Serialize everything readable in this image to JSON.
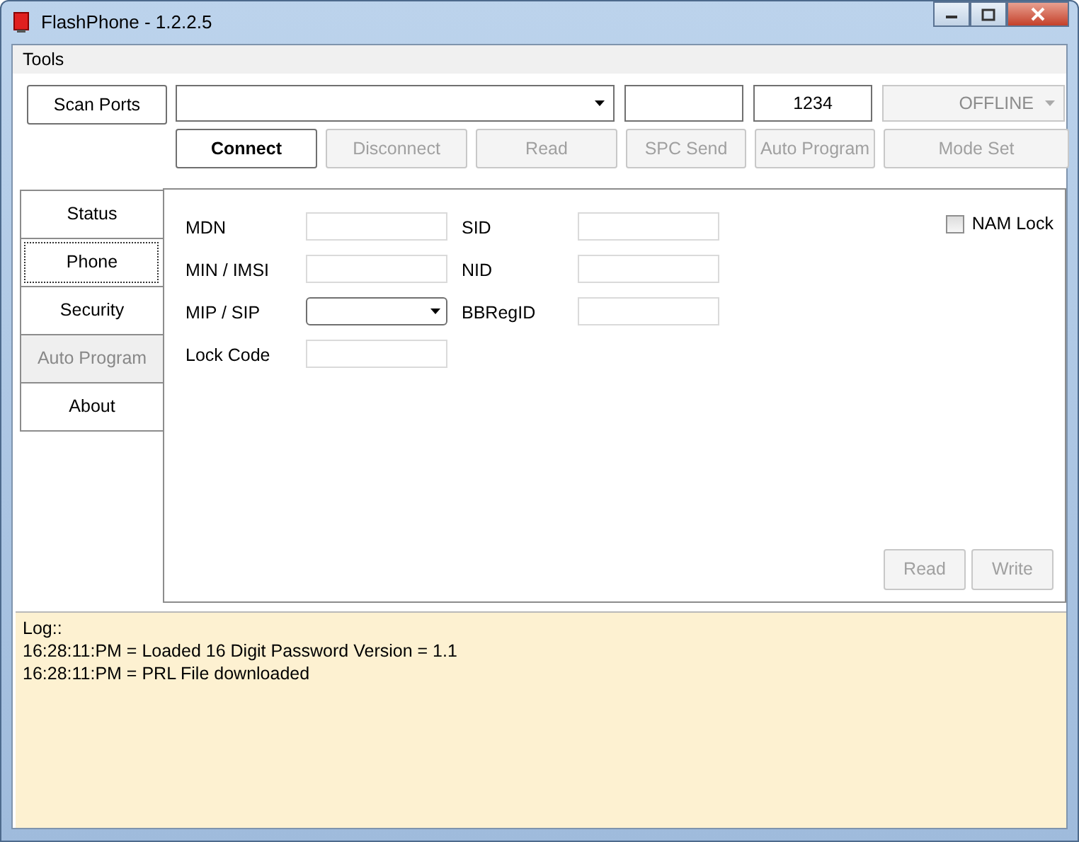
{
  "window": {
    "title": "FlashPhone - 1.2.2.5"
  },
  "menu": [
    {
      "label": "Tools"
    }
  ],
  "toolbar": {
    "scan_button": {
      "label": "Scan Ports",
      "disabled": false
    },
    "inputs": [
      {
        "kind": "select",
        "disabled": false
      },
      {
        "kind": "text",
        "disabled": false
      },
      {
        "kind": "text",
        "value": "1234",
        "disabled": false
      },
      {
        "kind": "select",
        "value": "OFFLINE",
        "disabled": true
      }
    ],
    "buttons": [
      {
        "label": "Connect",
        "disabled": false,
        "bold": true
      },
      {
        "label": "Disconnect",
        "disabled": true,
        "bold": false
      },
      {
        "label": "Read",
        "disabled": true,
        "bold": false
      },
      {
        "label": "SPC Send",
        "disabled": true,
        "bold": false
      },
      {
        "label": "Auto Program",
        "disabled": true,
        "bold": false
      },
      {
        "label": "Mode Set",
        "disabled": true,
        "bold": false
      }
    ]
  },
  "tabs": [
    {
      "label": "Status",
      "selected": false,
      "disabled": false
    },
    {
      "label": "Phone",
      "selected": true,
      "disabled": false
    },
    {
      "label": "Security",
      "selected": false,
      "disabled": false
    },
    {
      "label": "Auto Program",
      "selected": false,
      "disabled": true
    },
    {
      "label": "About",
      "selected": false,
      "disabled": false
    }
  ],
  "phone_panel": {
    "left_fields": [
      {
        "label": "MDN",
        "kind": "text"
      },
      {
        "label": "MIN / IMSI",
        "kind": "text"
      },
      {
        "label": "MIP / SIP",
        "kind": "select"
      },
      {
        "label": "Lock Code",
        "kind": "text"
      }
    ],
    "right_fields": [
      {
        "label": "SID",
        "kind": "text"
      },
      {
        "label": "NID",
        "kind": "text"
      },
      {
        "label": "BBRegID",
        "kind": "text"
      }
    ],
    "nam_lock": {
      "label": "NAM Lock",
      "checked": false
    },
    "buttons": [
      {
        "label": "Read",
        "disabled": true
      },
      {
        "label": "Write",
        "disabled": true
      }
    ]
  },
  "log": {
    "title": "Log::",
    "lines": [
      "16:28:11:PM = Loaded 16 Digit Password Version = 1.1",
      "16:28:11:PM = PRL File downloaded"
    ]
  }
}
